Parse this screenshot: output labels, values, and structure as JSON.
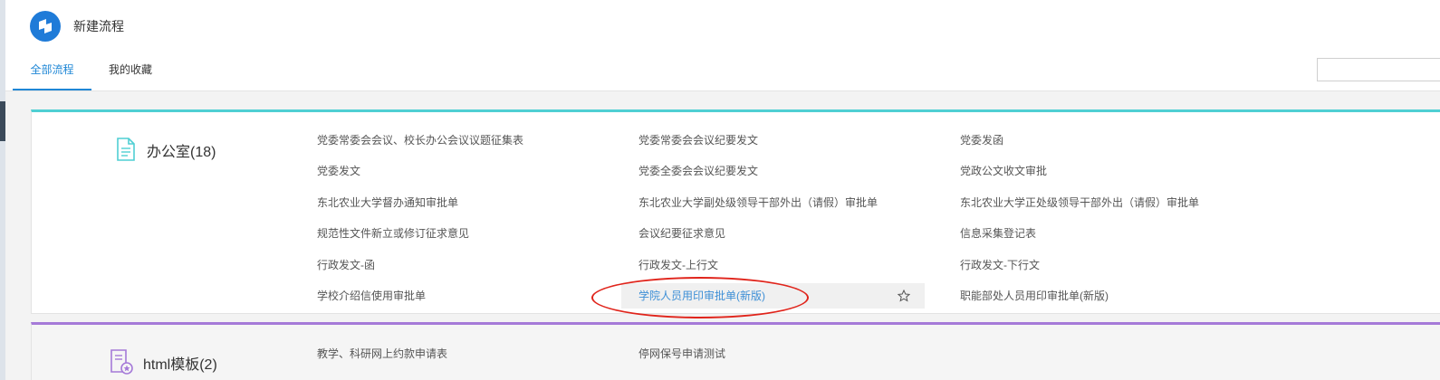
{
  "app": {
    "title": "新建流程"
  },
  "tabs": [
    {
      "label": "全部流程",
      "active": true
    },
    {
      "label": "我的收藏",
      "active": false
    }
  ],
  "search": {
    "placeholder": ""
  },
  "colors": {
    "accent": "#1f87d6",
    "office_bar": "#4fcfd3",
    "html_bar": "#a57ad8",
    "annotation": "#e0241b"
  },
  "categories": [
    {
      "title": "办公室(18)",
      "icon": "document-icon",
      "items": [
        [
          "党委常委会会议、校长办公会议议题征集表",
          "党委常委会会议纪要发文",
          "党委发函"
        ],
        [
          "党委发文",
          "党委全委会会议纪要发文",
          "党政公文收文审批"
        ],
        [
          "东北农业大学督办通知审批单",
          "东北农业大学副处级领导干部外出（请假）审批单",
          "东北农业大学正处级领导干部外出（请假）审批单"
        ],
        [
          "规范性文件新立或修订征求意见",
          "会议纪要征求意见",
          "信息采集登记表"
        ],
        [
          "行政发文-函",
          "行政发文-上行文",
          "行政发文-下行文"
        ],
        [
          "学校介绍信使用审批单",
          "学院人员用印审批单(新版)",
          "职能部处人员用印审批单(新版)"
        ]
      ]
    },
    {
      "title": "html模板(2)",
      "icon": "form-template-icon",
      "items": [
        [
          "教学、科研网上约款申请表",
          "停网保号申请测试"
        ]
      ]
    }
  ]
}
